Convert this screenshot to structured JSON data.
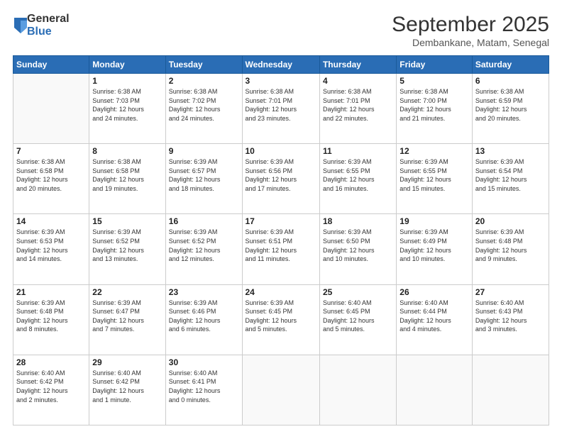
{
  "logo": {
    "general": "General",
    "blue": "Blue"
  },
  "header": {
    "month": "September 2025",
    "location": "Dembankane, Matam, Senegal"
  },
  "weekdays": [
    "Sunday",
    "Monday",
    "Tuesday",
    "Wednesday",
    "Thursday",
    "Friday",
    "Saturday"
  ],
  "weeks": [
    [
      {
        "day": "",
        "info": ""
      },
      {
        "day": "1",
        "info": "Sunrise: 6:38 AM\nSunset: 7:03 PM\nDaylight: 12 hours\nand 24 minutes."
      },
      {
        "day": "2",
        "info": "Sunrise: 6:38 AM\nSunset: 7:02 PM\nDaylight: 12 hours\nand 24 minutes."
      },
      {
        "day": "3",
        "info": "Sunrise: 6:38 AM\nSunset: 7:01 PM\nDaylight: 12 hours\nand 23 minutes."
      },
      {
        "day": "4",
        "info": "Sunrise: 6:38 AM\nSunset: 7:01 PM\nDaylight: 12 hours\nand 22 minutes."
      },
      {
        "day": "5",
        "info": "Sunrise: 6:38 AM\nSunset: 7:00 PM\nDaylight: 12 hours\nand 21 minutes."
      },
      {
        "day": "6",
        "info": "Sunrise: 6:38 AM\nSunset: 6:59 PM\nDaylight: 12 hours\nand 20 minutes."
      }
    ],
    [
      {
        "day": "7",
        "info": "Sunrise: 6:38 AM\nSunset: 6:58 PM\nDaylight: 12 hours\nand 20 minutes."
      },
      {
        "day": "8",
        "info": "Sunrise: 6:38 AM\nSunset: 6:58 PM\nDaylight: 12 hours\nand 19 minutes."
      },
      {
        "day": "9",
        "info": "Sunrise: 6:39 AM\nSunset: 6:57 PM\nDaylight: 12 hours\nand 18 minutes."
      },
      {
        "day": "10",
        "info": "Sunrise: 6:39 AM\nSunset: 6:56 PM\nDaylight: 12 hours\nand 17 minutes."
      },
      {
        "day": "11",
        "info": "Sunrise: 6:39 AM\nSunset: 6:55 PM\nDaylight: 12 hours\nand 16 minutes."
      },
      {
        "day": "12",
        "info": "Sunrise: 6:39 AM\nSunset: 6:55 PM\nDaylight: 12 hours\nand 15 minutes."
      },
      {
        "day": "13",
        "info": "Sunrise: 6:39 AM\nSunset: 6:54 PM\nDaylight: 12 hours\nand 15 minutes."
      }
    ],
    [
      {
        "day": "14",
        "info": "Sunrise: 6:39 AM\nSunset: 6:53 PM\nDaylight: 12 hours\nand 14 minutes."
      },
      {
        "day": "15",
        "info": "Sunrise: 6:39 AM\nSunset: 6:52 PM\nDaylight: 12 hours\nand 13 minutes."
      },
      {
        "day": "16",
        "info": "Sunrise: 6:39 AM\nSunset: 6:52 PM\nDaylight: 12 hours\nand 12 minutes."
      },
      {
        "day": "17",
        "info": "Sunrise: 6:39 AM\nSunset: 6:51 PM\nDaylight: 12 hours\nand 11 minutes."
      },
      {
        "day": "18",
        "info": "Sunrise: 6:39 AM\nSunset: 6:50 PM\nDaylight: 12 hours\nand 10 minutes."
      },
      {
        "day": "19",
        "info": "Sunrise: 6:39 AM\nSunset: 6:49 PM\nDaylight: 12 hours\nand 10 minutes."
      },
      {
        "day": "20",
        "info": "Sunrise: 6:39 AM\nSunset: 6:48 PM\nDaylight: 12 hours\nand 9 minutes."
      }
    ],
    [
      {
        "day": "21",
        "info": "Sunrise: 6:39 AM\nSunset: 6:48 PM\nDaylight: 12 hours\nand 8 minutes."
      },
      {
        "day": "22",
        "info": "Sunrise: 6:39 AM\nSunset: 6:47 PM\nDaylight: 12 hours\nand 7 minutes."
      },
      {
        "day": "23",
        "info": "Sunrise: 6:39 AM\nSunset: 6:46 PM\nDaylight: 12 hours\nand 6 minutes."
      },
      {
        "day": "24",
        "info": "Sunrise: 6:39 AM\nSunset: 6:45 PM\nDaylight: 12 hours\nand 5 minutes."
      },
      {
        "day": "25",
        "info": "Sunrise: 6:40 AM\nSunset: 6:45 PM\nDaylight: 12 hours\nand 5 minutes."
      },
      {
        "day": "26",
        "info": "Sunrise: 6:40 AM\nSunset: 6:44 PM\nDaylight: 12 hours\nand 4 minutes."
      },
      {
        "day": "27",
        "info": "Sunrise: 6:40 AM\nSunset: 6:43 PM\nDaylight: 12 hours\nand 3 minutes."
      }
    ],
    [
      {
        "day": "28",
        "info": "Sunrise: 6:40 AM\nSunset: 6:42 PM\nDaylight: 12 hours\nand 2 minutes."
      },
      {
        "day": "29",
        "info": "Sunrise: 6:40 AM\nSunset: 6:42 PM\nDaylight: 12 hours\nand 1 minute."
      },
      {
        "day": "30",
        "info": "Sunrise: 6:40 AM\nSunset: 6:41 PM\nDaylight: 12 hours\nand 0 minutes."
      },
      {
        "day": "",
        "info": ""
      },
      {
        "day": "",
        "info": ""
      },
      {
        "day": "",
        "info": ""
      },
      {
        "day": "",
        "info": ""
      }
    ]
  ]
}
